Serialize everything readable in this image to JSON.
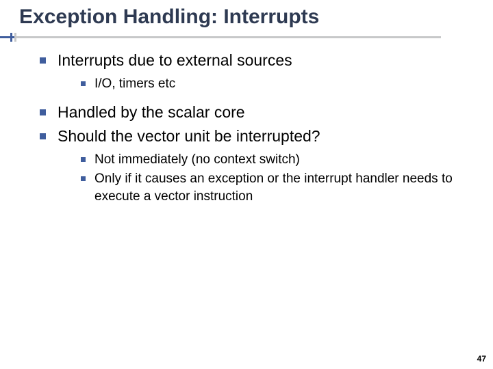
{
  "title": "Exception Handling: Interrupts",
  "bullets": {
    "b0": "Interrupts due to external sources",
    "b0_s0": "I/O, timers etc",
    "b1": "Handled by the scalar core",
    "b2": "Should the vector unit be interrupted?",
    "b2_s0": "Not immediately (no context switch)",
    "b2_s1": "Only if it causes an exception or the interrupt handler needs to execute a vector instruction"
  },
  "page_number": "47"
}
